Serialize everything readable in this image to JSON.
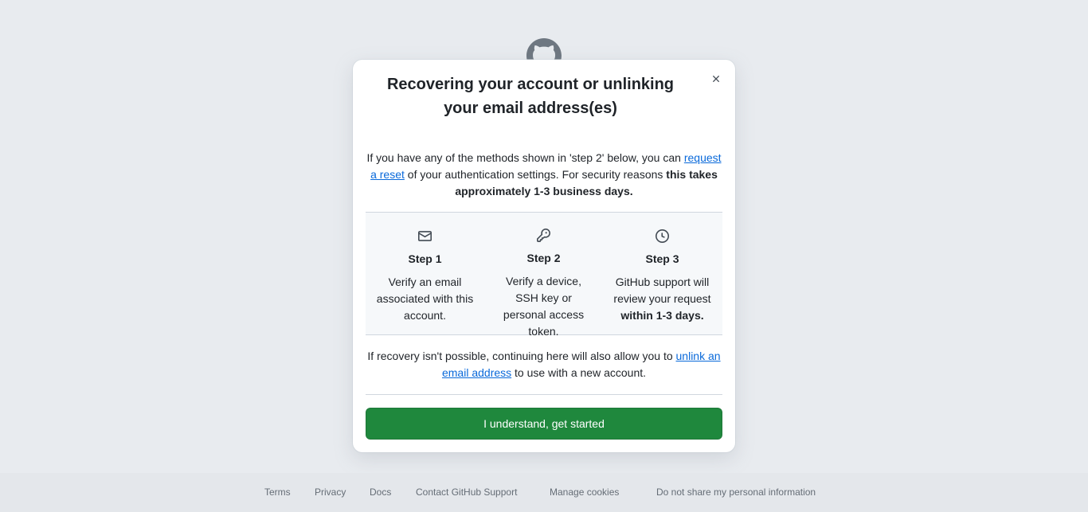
{
  "modal": {
    "title": "Recovering your account or unlinking your email address(es)",
    "intro": {
      "text_before": "If you have any of the methods shown in 'step 2' below, you can ",
      "link": "request a reset",
      "text_after": " of your authentication settings. For security reasons ",
      "bold": "this takes approximately 1-3 business days."
    },
    "steps": [
      {
        "icon": "mail-icon",
        "heading": "Step 1",
        "description": "Verify an email associated with this account.",
        "bold": ""
      },
      {
        "icon": "key-icon",
        "heading": "Step 2",
        "description": "Verify a device, SSH key or personal access token.",
        "bold": ""
      },
      {
        "icon": "clock-icon",
        "heading": "Step 3",
        "description": "GitHub support will review your request ",
        "bold": "within 1-3 days."
      }
    ],
    "recovery": {
      "text_before": "If recovery isn't possible, continuing here will also allow you to ",
      "link": "unlink an email address",
      "text_after": " to use with a new account."
    },
    "cta_label": "I understand, get started"
  },
  "footer": {
    "links": [
      "Terms",
      "Privacy",
      "Docs",
      "Contact GitHub Support",
      "Manage cookies",
      "Do not share my personal information"
    ]
  },
  "colors": {
    "background": "#e8ebef",
    "primary_button": "#1f883d",
    "link": "#0969da",
    "footer_text": "#656d76"
  }
}
